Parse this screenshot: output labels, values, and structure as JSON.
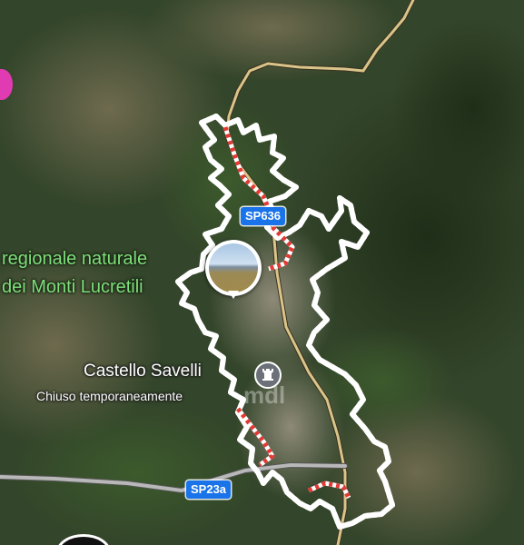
{
  "map": {
    "type": "satellite",
    "roads": [
      {
        "ref": "SP636",
        "color": "#1a73e8"
      },
      {
        "ref": "SP23a",
        "color": "#1a73e8"
      }
    ],
    "labels": {
      "park_line1": "regionale naturale",
      "park_line2": "dei Monti Lucretili",
      "poi_name": "Castello Savelli",
      "poi_status": "Chiuso temporaneamente"
    },
    "colors": {
      "park_label": "#7ee07a",
      "boundary_red": "#e53935",
      "boundary_white": "#ffffff",
      "road_gold": "#d9c48a",
      "marker_pink": "#e03bb3"
    },
    "icons": {
      "photo_pin": "photo-pin-icon",
      "poi": "castle-icon",
      "edge": "place-marker-icon"
    },
    "watermark": "mdl"
  }
}
